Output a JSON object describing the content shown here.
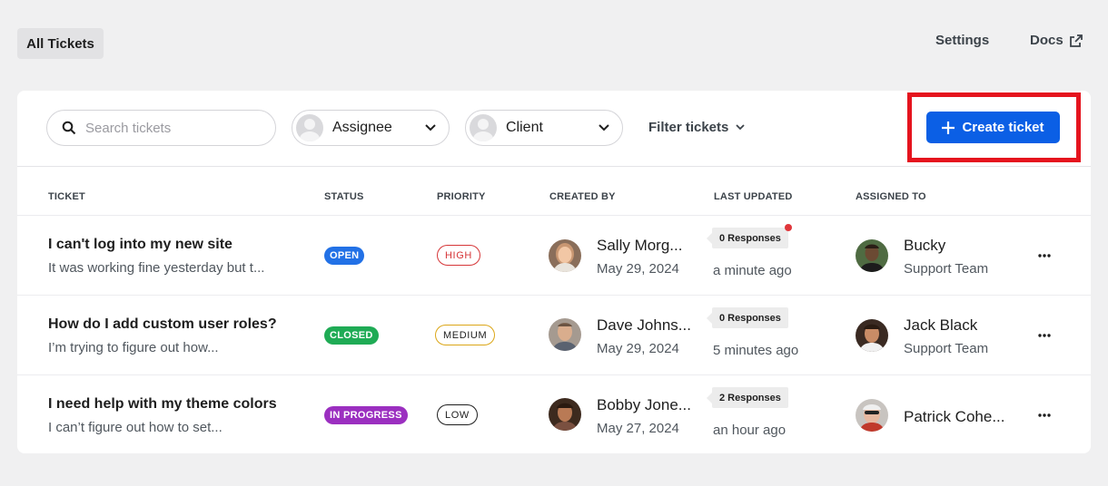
{
  "header": {
    "tab_all_tickets": "All Tickets",
    "settings_label": "Settings",
    "docs_label": "Docs"
  },
  "toolbar": {
    "search_placeholder": "Search tickets",
    "assignee_label": "Assignee",
    "client_label": "Client",
    "filter_label": "Filter tickets",
    "create_label": "Create ticket"
  },
  "columns": [
    "TICKET",
    "STATUS",
    "PRIORITY",
    "CREATED BY",
    "LAST UPDATED",
    "ASSIGNED TO"
  ],
  "tickets": [
    {
      "title": "I can't log into my new site",
      "excerpt": "It was working fine yesterday but t...",
      "status": "OPEN",
      "priority": "HIGH",
      "created_by": "Sally Morg...",
      "created_date": "May 29, 2024",
      "responses": "0 Responses",
      "updated": "a minute ago",
      "assignee": "Bucky",
      "team": "Support Team"
    },
    {
      "title": "How do I add custom user roles?",
      "excerpt": "I’m trying to figure out how...",
      "status": "CLOSED",
      "priority": "MEDIUM",
      "created_by": "Dave Johns...",
      "created_date": "May 29, 2024",
      "responses": "0 Responses",
      "updated": "5 minutes ago",
      "assignee": "Jack Black",
      "team": "Support Team"
    },
    {
      "title": "I need help with my theme colors",
      "excerpt": "I can’t figure out how to set...",
      "status": "IN PROGRESS",
      "priority": "LOW",
      "created_by": "Bobby Jone...",
      "created_date": "May 27, 2024",
      "responses": "2 Responses",
      "updated": "an hour ago",
      "assignee": "Patrick Cohe...",
      "team": ""
    }
  ],
  "colors": {
    "accent": "#0b5fe5",
    "highlight_frame": "#e5141e",
    "status_open": "#2271e6",
    "status_closed": "#1fab55",
    "status_in_progress": "#9b2fc0",
    "priority_high": "#d63638",
    "priority_medium": "#dba617",
    "priority_low": "#1e1e1e"
  }
}
